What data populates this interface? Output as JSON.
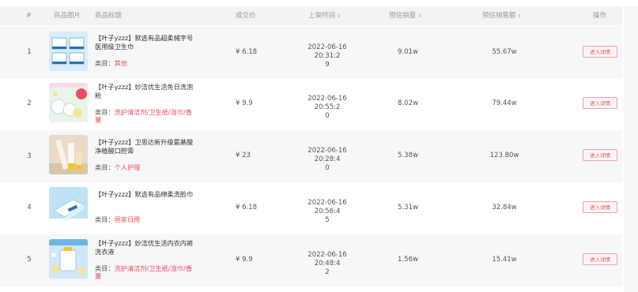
{
  "columns": {
    "index": "#",
    "image": "商品图片",
    "title": "商品标题",
    "price": "成交价",
    "listed_time": "上架时间",
    "est_sales": "预估销量",
    "est_revenue": "预估销售额",
    "action": "操作"
  },
  "sort_glyph": "⇕",
  "category_label": "类目：",
  "rows": [
    {
      "index": "1",
      "title": "【叶子yzzz】默选有品超柔械字号医用级卫生巾",
      "category": "其他",
      "price": "¥ 6.18",
      "time_line1": "2022-06-16 20:31:2",
      "time_line2": "9",
      "sales": "9.01w",
      "revenue": "55.67w",
      "button": "进入详情",
      "image_icon": "sanitary-pad-product-icon"
    },
    {
      "index": "2",
      "title": "【叶子yzzz】妙洁优生活免日洗泡粉",
      "category": "洗护清洁剂/卫生纸/湿巾/香薰",
      "price": "¥ 9.9",
      "time_line1": "2022-06-16 20:55:2",
      "time_line2": "0",
      "sales": "8.02w",
      "revenue": "79.44w",
      "button": "进入详情",
      "image_icon": "laundry-powder-product-icon"
    },
    {
      "index": "3",
      "title": "【叶子yzzz】卫思达新升级氨基酸净植酸口腔膏",
      "category": "个人护理",
      "price": "¥ 23",
      "time_line1": "2022-06-16 20:28:4",
      "time_line2": "0",
      "sales": "5.38w",
      "revenue": "123.80w",
      "button": "进入详情",
      "image_icon": "toothpaste-product-icon"
    },
    {
      "index": "4",
      "title": "【叶子yzzz】默选有品绵柔洗脸巾",
      "category": "居家日用",
      "price": "¥ 6.18",
      "time_line1": "2022-06-16 20:56:4",
      "time_line2": "5",
      "sales": "5.31w",
      "revenue": "32.84w",
      "button": "进入详情",
      "image_icon": "face-towel-product-icon"
    },
    {
      "index": "5",
      "title": "【叶子yzzz】妙洁优生活内衣内裤洗衣液",
      "category": "洗护清洁剂/卫生纸/湿巾/香薰",
      "price": "¥ 9.9",
      "time_line1": "2022-06-16 20:48:4",
      "time_line2": "2",
      "sales": "1.56w",
      "revenue": "15.41w",
      "button": "进入详情",
      "image_icon": "detergent-product-icon"
    }
  ],
  "colors": {
    "accent": "#ee4d62",
    "header_bg": "#f3f3f4",
    "alt_row_bg": "#f6f7f9"
  }
}
